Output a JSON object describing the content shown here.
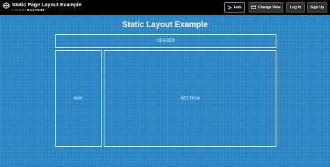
{
  "topbar": {
    "pen_title": "Static Page Layout Example",
    "byline_prefix": "A PEN BY",
    "author": "Nick Pettit",
    "buttons": {
      "fork": "Fork",
      "change_view": "Change View",
      "login": "Log In",
      "signup": "Sign Up"
    }
  },
  "page": {
    "title": "Static Layout Example",
    "header_label": "HEADER",
    "nav_label": "NAV",
    "section_label": "SECTION"
  },
  "colors": {
    "topbar_background": "#000000",
    "page_background": "#2b85c4",
    "box_border": "#e8f2fa",
    "text": "#ffffff"
  }
}
